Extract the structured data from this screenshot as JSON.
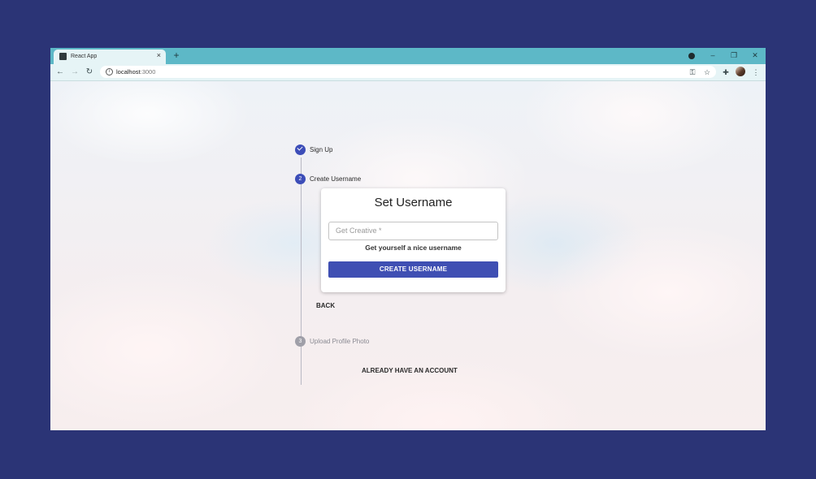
{
  "browser": {
    "tab_title": "React App",
    "tab_close": "×",
    "new_tab": "+",
    "url_host": "localhost",
    "url_port": ":3000",
    "window_controls": {
      "minimize": "–",
      "restore": "❐",
      "close": "✕"
    }
  },
  "toolbar_icons": [
    "arrow-left-icon",
    "arrow-right-icon",
    "reload-icon",
    "key-icon",
    "star-icon",
    "extensions-icon",
    "avatar",
    "kebab-menu-icon"
  ],
  "stepper": {
    "steps": [
      {
        "number": "",
        "label": "Sign Up",
        "state": "completed"
      },
      {
        "number": "2",
        "label": "Create Username",
        "state": "active"
      },
      {
        "number": "3",
        "label": "Upload Profile Photo",
        "state": "pending"
      }
    ]
  },
  "card": {
    "title": "Set Username",
    "input_placeholder": "Get Creative *",
    "input_value": "",
    "helper_text": "Get yourself a nice username",
    "submit_label": "CREATE USERNAME"
  },
  "back_label": "BACK",
  "account_link": "ALREADY HAVE AN ACCOUNT",
  "colors": {
    "background": "#2b3476",
    "titlebar": "#5db8c7",
    "accent": "#3f4fb3",
    "pending": "#9f9fa8"
  }
}
